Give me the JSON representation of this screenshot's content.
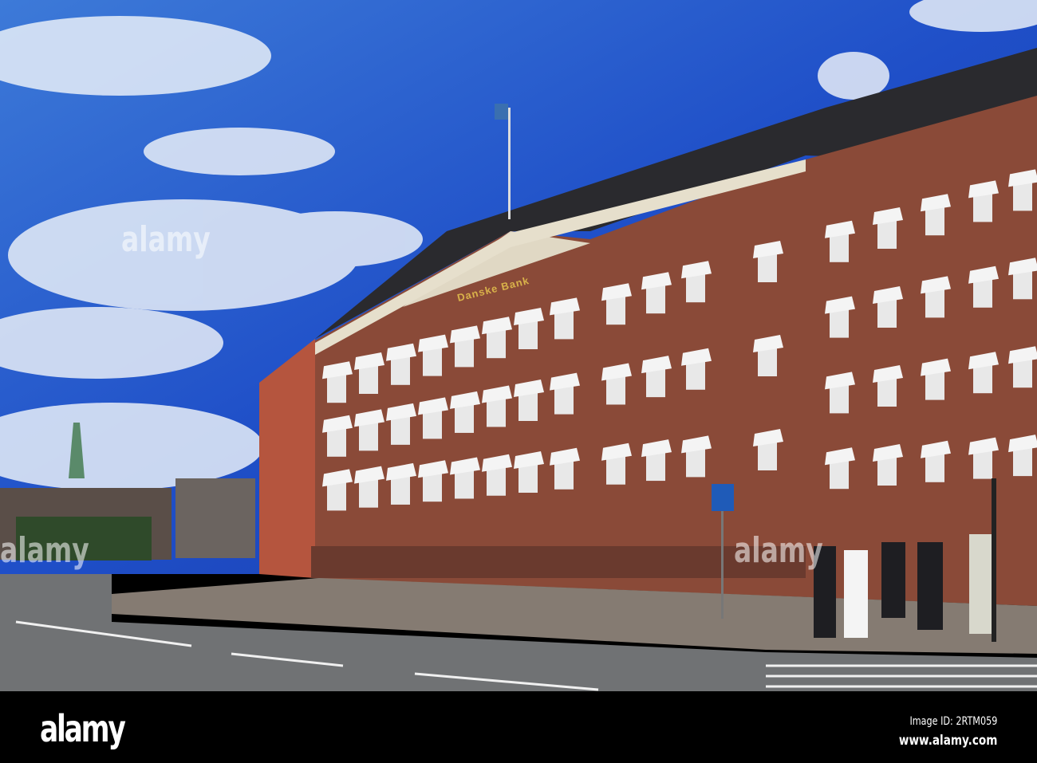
{
  "photo": {
    "building_sign": "Danske Bank",
    "watermark": "alamy"
  },
  "footer": {
    "logo": "alamy",
    "image_id": "Image ID: 2RTM059",
    "website": "www.alamy.com"
  },
  "colors": {
    "sky": "#2a5fd0",
    "brick": "#8a4a38",
    "awning": "#f2f2f2",
    "road": "#6e6f70",
    "footer": "#000000"
  }
}
